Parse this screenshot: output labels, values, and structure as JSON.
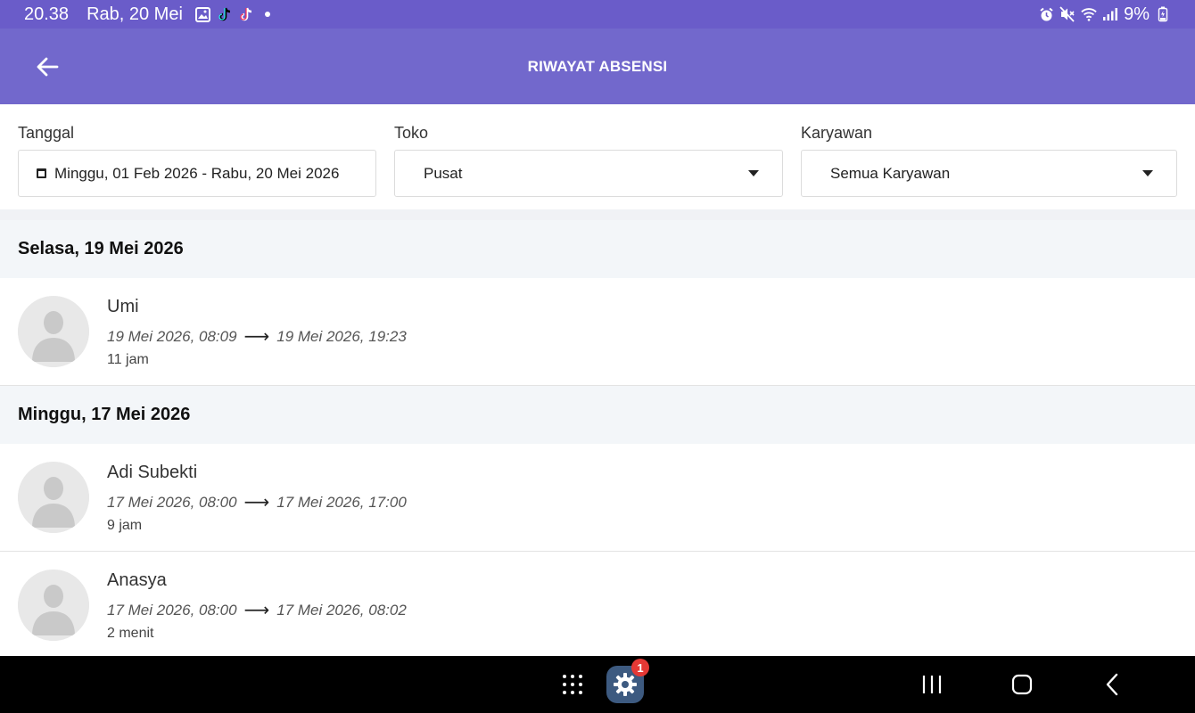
{
  "status_bar": {
    "time": "20.38",
    "date": "Rab, 20 Mei",
    "battery": "9%"
  },
  "app_bar": {
    "title": "RIWAYAT ABSENSI"
  },
  "filters": {
    "date_label": "Tanggal",
    "date_value": "Minggu, 01 Feb 2026 - Rabu, 20 Mei 2026",
    "store_label": "Toko",
    "store_value": "Pusat",
    "employee_label": "Karyawan",
    "employee_value": "Semua Karyawan"
  },
  "groups": [
    {
      "date": "Selasa, 19 Mei 2026",
      "entries": [
        {
          "name": "Umi",
          "check_in": "19 Mei 2026, 08:09",
          "check_out": "19 Mei 2026, 19:23",
          "duration": "11 jam"
        }
      ]
    },
    {
      "date": "Minggu, 17 Mei 2026",
      "entries": [
        {
          "name": "Adi Subekti",
          "check_in": "17 Mei 2026, 08:00",
          "check_out": "17 Mei 2026, 17:00",
          "duration": "9 jam"
        },
        {
          "name": "Anasya",
          "check_in": "17 Mei 2026, 08:00",
          "check_out": "17 Mei 2026, 08:02",
          "duration": "2 menit"
        }
      ]
    }
  ],
  "nav_bar": {
    "settings_badge": "1"
  },
  "colors": {
    "status_bar": "#6a5cc9",
    "app_bar": "#7268cc",
    "group_header_bg": "#f3f6f9",
    "badge": "#e53935"
  }
}
